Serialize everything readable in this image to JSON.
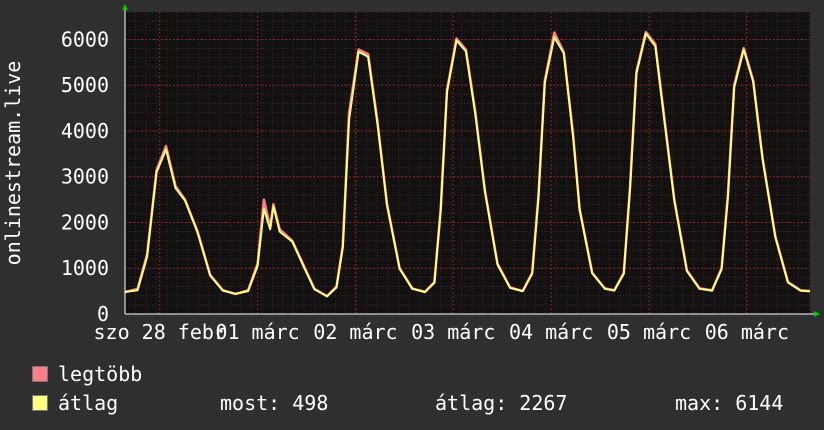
{
  "chart_data": {
    "type": "line",
    "ylabel": "onlinestream.live",
    "ylim": [
      0,
      6600
    ],
    "y_ticks": [
      0,
      1000,
      2000,
      3000,
      4000,
      5000,
      6000
    ],
    "x_ticks": [
      "szo 28 febr",
      "01 márc",
      "02 márc",
      "03 márc",
      "04 márc",
      "05 márc",
      "06 márc"
    ],
    "x_range_days": [
      0,
      7.65
    ],
    "grid": true,
    "series": [
      {
        "name": "legtöbb",
        "color": "#ff7f86",
        "points": [
          [
            0,
            480
          ],
          [
            0.2,
            550
          ],
          [
            0.35,
            1300
          ],
          [
            0.5,
            3150
          ],
          [
            0.65,
            3670
          ],
          [
            0.8,
            2800
          ],
          [
            0.95,
            2500
          ],
          [
            1.15,
            1800
          ],
          [
            1.35,
            850
          ],
          [
            1.55,
            520
          ],
          [
            1.75,
            440
          ],
          [
            1.95,
            520
          ],
          [
            2.1,
            1100
          ],
          [
            2.2,
            2500
          ],
          [
            2.3,
            1900
          ],
          [
            2.35,
            2400
          ],
          [
            2.45,
            1850
          ],
          [
            2.65,
            1600
          ],
          [
            2.85,
            1000
          ],
          [
            3.0,
            550
          ],
          [
            3.2,
            390
          ],
          [
            3.35,
            600
          ],
          [
            3.45,
            1500
          ],
          [
            3.55,
            4400
          ],
          [
            3.7,
            5780
          ],
          [
            3.85,
            5680
          ],
          [
            4.0,
            4200
          ],
          [
            4.15,
            2400
          ],
          [
            4.35,
            1000
          ],
          [
            4.55,
            560
          ],
          [
            4.75,
            480
          ],
          [
            4.9,
            700
          ],
          [
            5.0,
            2300
          ],
          [
            5.1,
            4900
          ],
          [
            5.25,
            6020
          ],
          [
            5.4,
            5780
          ],
          [
            5.55,
            4400
          ],
          [
            5.7,
            2700
          ],
          [
            5.9,
            1100
          ],
          [
            6.1,
            580
          ],
          [
            6.3,
            500
          ],
          [
            6.45,
            900
          ],
          [
            6.55,
            2600
          ],
          [
            6.65,
            5100
          ],
          [
            6.8,
            6150
          ],
          [
            6.95,
            5720
          ],
          [
            7.1,
            3900
          ],
          [
            7.2,
            2300
          ],
          [
            7.4,
            900
          ],
          [
            7.6,
            560
          ],
          [
            7.75,
            520
          ],
          [
            7.9,
            900
          ],
          [
            8.0,
            2800
          ],
          [
            8.1,
            5300
          ],
          [
            8.25,
            6160
          ],
          [
            8.4,
            5900
          ],
          [
            8.55,
            4200
          ],
          [
            8.7,
            2500
          ],
          [
            8.9,
            950
          ],
          [
            9.1,
            560
          ],
          [
            9.3,
            520
          ],
          [
            9.45,
            1000
          ],
          [
            9.55,
            2600
          ],
          [
            9.65,
            5000
          ],
          [
            9.8,
            5810
          ],
          [
            9.95,
            5100
          ],
          [
            10.1,
            3400
          ],
          [
            10.3,
            1700
          ],
          [
            10.5,
            700
          ],
          [
            10.7,
            520
          ],
          [
            10.85,
            500
          ]
        ]
      },
      {
        "name": "átlag",
        "color": "#ffff80",
        "points": [
          [
            0,
            480
          ],
          [
            0.2,
            520
          ],
          [
            0.35,
            1250
          ],
          [
            0.5,
            3100
          ],
          [
            0.65,
            3600
          ],
          [
            0.8,
            2750
          ],
          [
            0.95,
            2480
          ],
          [
            1.15,
            1780
          ],
          [
            1.35,
            840
          ],
          [
            1.55,
            510
          ],
          [
            1.75,
            440
          ],
          [
            1.95,
            500
          ],
          [
            2.1,
            1050
          ],
          [
            2.2,
            2300
          ],
          [
            2.3,
            1850
          ],
          [
            2.35,
            2350
          ],
          [
            2.45,
            1800
          ],
          [
            2.65,
            1580
          ],
          [
            2.85,
            980
          ],
          [
            3.0,
            540
          ],
          [
            3.2,
            390
          ],
          [
            3.35,
            580
          ],
          [
            3.45,
            1450
          ],
          [
            3.55,
            4250
          ],
          [
            3.7,
            5730
          ],
          [
            3.85,
            5620
          ],
          [
            4.0,
            4150
          ],
          [
            4.15,
            2380
          ],
          [
            4.35,
            990
          ],
          [
            4.55,
            550
          ],
          [
            4.75,
            480
          ],
          [
            4.9,
            680
          ],
          [
            5.0,
            2250
          ],
          [
            5.1,
            4850
          ],
          [
            5.25,
            5980
          ],
          [
            5.4,
            5740
          ],
          [
            5.55,
            4350
          ],
          [
            5.7,
            2680
          ],
          [
            5.9,
            1080
          ],
          [
            6.1,
            570
          ],
          [
            6.3,
            500
          ],
          [
            6.45,
            880
          ],
          [
            6.55,
            2550
          ],
          [
            6.65,
            5050
          ],
          [
            6.8,
            6050
          ],
          [
            6.95,
            5700
          ],
          [
            7.1,
            3850
          ],
          [
            7.2,
            2280
          ],
          [
            7.4,
            890
          ],
          [
            7.6,
            550
          ],
          [
            7.75,
            510
          ],
          [
            7.9,
            880
          ],
          [
            8.0,
            2750
          ],
          [
            8.1,
            5250
          ],
          [
            8.25,
            6130
          ],
          [
            8.4,
            5850
          ],
          [
            8.55,
            4150
          ],
          [
            8.7,
            2480
          ],
          [
            8.9,
            940
          ],
          [
            9.1,
            550
          ],
          [
            9.3,
            510
          ],
          [
            9.45,
            980
          ],
          [
            9.55,
            2550
          ],
          [
            9.65,
            4950
          ],
          [
            9.8,
            5780
          ],
          [
            9.95,
            5080
          ],
          [
            10.1,
            3380
          ],
          [
            10.3,
            1680
          ],
          [
            10.5,
            690
          ],
          [
            10.7,
            510
          ],
          [
            10.85,
            498
          ]
        ]
      }
    ]
  },
  "legend": {
    "items": [
      {
        "label": "legtöbb",
        "color": "#ff7f86"
      },
      {
        "label": "átlag",
        "color": "#ffff80"
      }
    ],
    "stats": {
      "most": "most: 498",
      "atlag": "átlag: 2267",
      "max": "max: 6144"
    }
  }
}
